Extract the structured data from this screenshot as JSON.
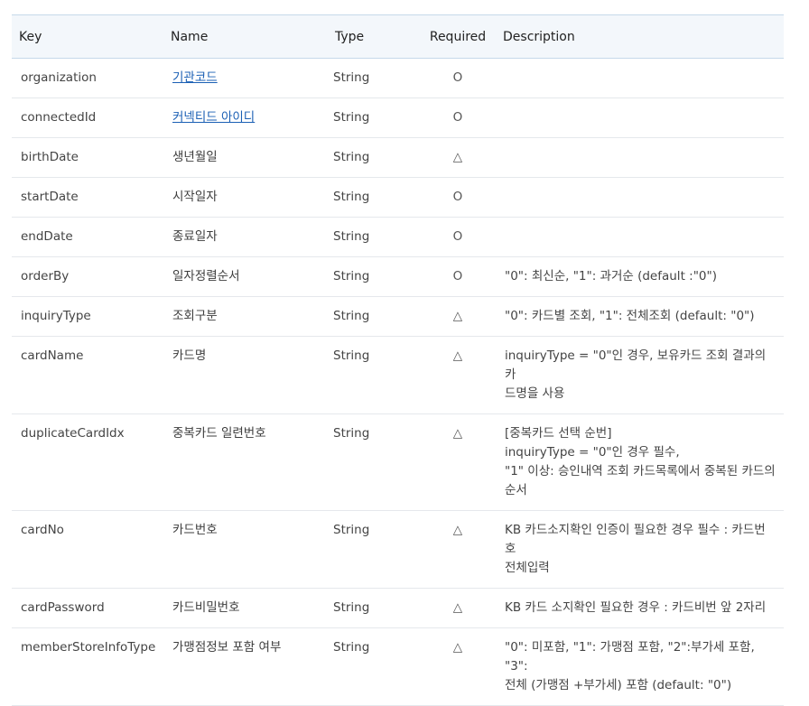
{
  "columns": {
    "key": "Key",
    "name": "Name",
    "type": "Type",
    "required": "Required",
    "description": "Description"
  },
  "rows": [
    {
      "key": "organization",
      "name": "기관코드",
      "name_is_link": true,
      "type": "String",
      "required": "O",
      "description": []
    },
    {
      "key": "connectedId",
      "name": "커넥티드 아이디",
      "name_is_link": true,
      "type": "String",
      "required": "O",
      "description": []
    },
    {
      "key": "birthDate",
      "name": "생년월일",
      "type": "String",
      "required": "△",
      "description": []
    },
    {
      "key": "startDate",
      "name": "시작일자",
      "type": "String",
      "required": "O",
      "description": []
    },
    {
      "key": "endDate",
      "name": "종료일자",
      "type": "String",
      "required": "O",
      "description": []
    },
    {
      "key": "orderBy",
      "name": "일자정렬순서",
      "type": "String",
      "required": "O",
      "description": [
        "\"0\": 최신순, \"1\": 과거순 (default :\"0\")"
      ]
    },
    {
      "key": "inquiryType",
      "name": "조회구분",
      "type": "String",
      "required": "△",
      "description": [
        "\"0\": 카드별 조회, \"1\": 전체조회 (default: \"0\")"
      ]
    },
    {
      "key": "cardName",
      "name": "카드명",
      "type": "String",
      "required": "△",
      "description": [
        "inquiryType = \"0\"인 경우, 보유카드 조회 결과의 카",
        "드명을 사용"
      ]
    },
    {
      "key": "duplicateCardIdx",
      "name": "중복카드 일련번호",
      "type": "String",
      "required": "△",
      "description": [
        "[중복카드 선택 순번]",
        "inquiryType = \"0\"인 경우 필수,",
        "\"1\" 이상: 승인내역 조회 카드목록에서 중복된 카드의",
        "순서"
      ]
    },
    {
      "key": "cardNo",
      "name": "카드번호",
      "type": "String",
      "required": "△",
      "description": [
        "KB 카드소지확인 인증이 필요한 경우 필수 : 카드번호",
        "전체입력"
      ]
    },
    {
      "key": "cardPassword",
      "name": "카드비밀번호",
      "type": "String",
      "required": "△",
      "description": [
        "KB 카드 소지확인 필요한 경우 : 카드비번 앞 2자리"
      ]
    },
    {
      "key": "memberStoreInfoType",
      "name": "가맹점정보 포함 여부",
      "type": "String",
      "required": "△",
      "description": [
        "\"0\": 미포함, \"1\": 가맹점 포함, \"2\":부가세 포함, \"3\":",
        "전체 (가맹점 +부가세) 포함 (default: \"0\")"
      ]
    }
  ]
}
